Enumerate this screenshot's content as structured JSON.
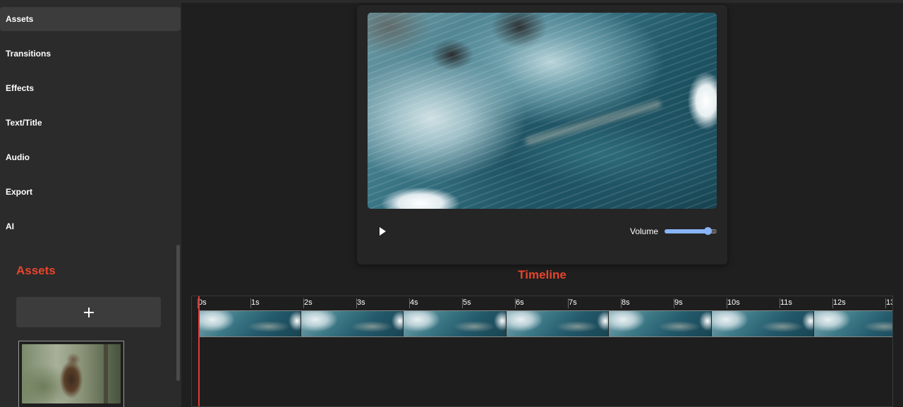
{
  "sidebar": {
    "nav": [
      {
        "label": "Assets",
        "active": true
      },
      {
        "label": "Transitions",
        "active": false
      },
      {
        "label": "Effects",
        "active": false
      },
      {
        "label": "Text/Title",
        "active": false
      },
      {
        "label": "Audio",
        "active": false
      },
      {
        "label": "Export",
        "active": false
      },
      {
        "label": "AI",
        "active": false
      }
    ],
    "assets_heading": "Assets",
    "add_button_icon": "plus-icon",
    "assets": [
      {
        "icon": "hawk-photo-thumbnail"
      }
    ]
  },
  "player": {
    "play_icon": "play-icon",
    "volume_label": "Volume",
    "volume_level": 0.82,
    "accent_color": "#8ab4f8"
  },
  "timeline": {
    "heading": "Timeline",
    "heading_color": "#e8452c",
    "ticks": [
      "0s",
      "1s",
      "2s",
      "3s",
      "4s",
      "5s",
      "6s",
      "7s",
      "8s",
      "9s",
      "10s",
      "11s",
      "12s",
      "13"
    ],
    "playhead_color": "#e53935",
    "playhead_seconds": 0
  }
}
